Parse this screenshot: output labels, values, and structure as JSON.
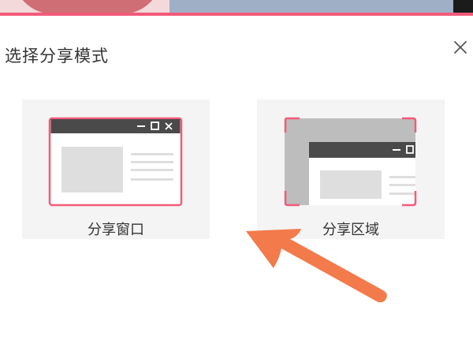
{
  "dialog": {
    "title": "选择分享模式",
    "close_icon": "close-icon"
  },
  "options": [
    {
      "label": "分享窗口",
      "icon": "window-share-icon"
    },
    {
      "label": "分享区域",
      "icon": "region-share-icon"
    }
  ],
  "colors": {
    "accent": "#f35a7a",
    "card_bg": "#f4f4f4",
    "titlebar": "#4a4a4a",
    "placeholder": "#dedede",
    "annotation_arrow": "#f27a4b"
  }
}
